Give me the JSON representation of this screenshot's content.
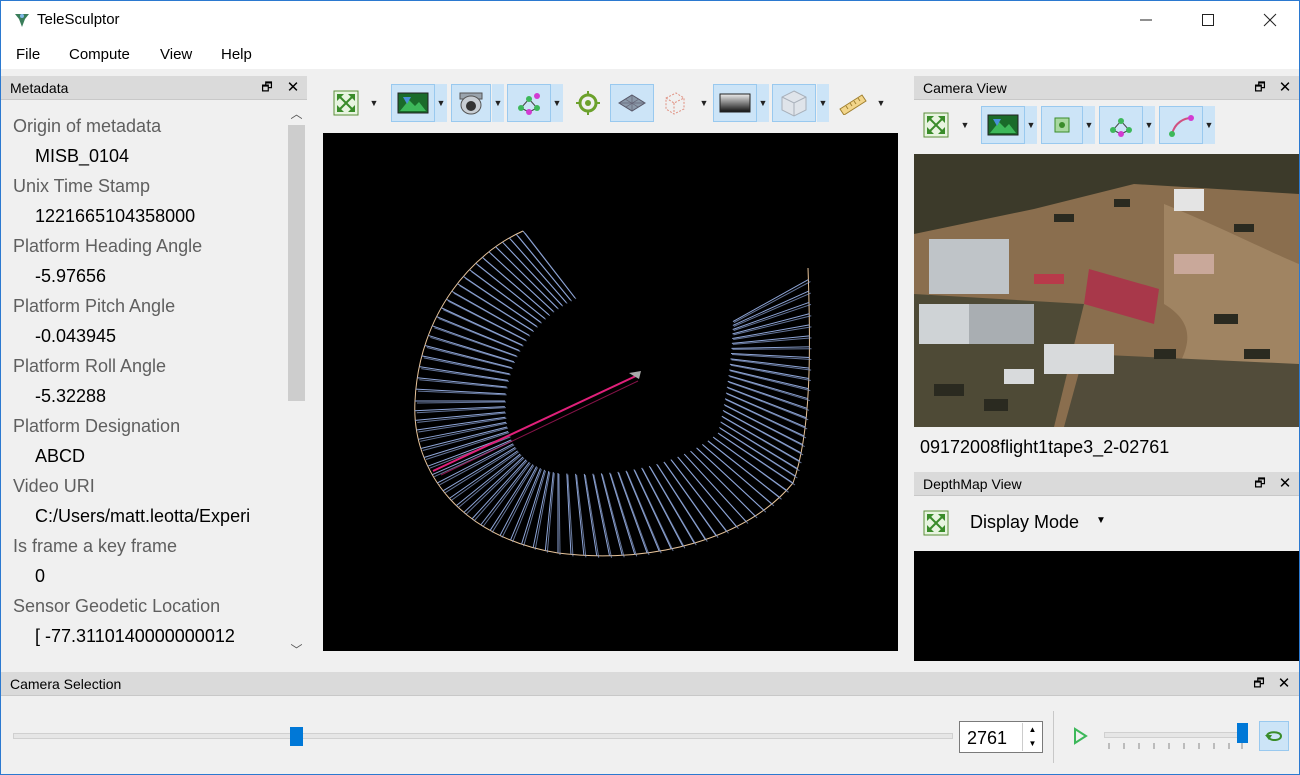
{
  "app": {
    "title": "TeleSculptor"
  },
  "menu": {
    "file": "File",
    "compute": "Compute",
    "view": "View",
    "help": "Help"
  },
  "metadata_panel": {
    "title": "Metadata",
    "items": [
      {
        "label": "Origin of metadata",
        "value": "MISB_0104"
      },
      {
        "label": "Unix Time Stamp",
        "value": "1221665104358000"
      },
      {
        "label": "Platform Heading Angle",
        "value": "-5.97656"
      },
      {
        "label": "Platform Pitch Angle",
        "value": "-0.043945"
      },
      {
        "label": "Platform Roll Angle",
        "value": "-5.32288"
      },
      {
        "label": "Platform Designation",
        "value": "ABCD"
      },
      {
        "label": "Video URI",
        "value": "C:/Users/matt.leotta/Experi"
      },
      {
        "label": "Is frame a key frame",
        "value": "0"
      },
      {
        "label": "Sensor Geodetic Location",
        "value": "[ -77.3110140000000012"
      }
    ]
  },
  "camera_view": {
    "title": "Camera View",
    "frame_name": "09172008flight1tape3_2-02761"
  },
  "depthmap_view": {
    "title": "DepthMap View",
    "display_mode": "Display Mode"
  },
  "camera_selection": {
    "title": "Camera Selection",
    "frame_value": "2761"
  },
  "colors": {
    "accent": "#0078d7",
    "path_highlight": "#e0207a",
    "camera_frustum": "#8fa6d8"
  }
}
